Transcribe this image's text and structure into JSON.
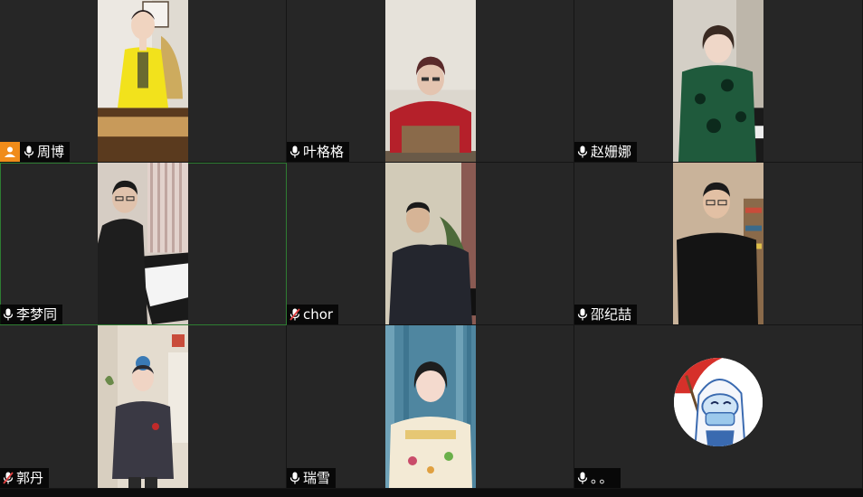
{
  "participants": [
    {
      "name": "周博",
      "muted": false,
      "host": true,
      "video_tone": "#d9c79a",
      "shirt": "#f2e21c",
      "bg": "#e8e4de"
    },
    {
      "name": "叶格格",
      "muted": false,
      "host": false,
      "video_tone": "#c9c2b8",
      "shirt": "#b5202a",
      "bg": "#d9d3c8"
    },
    {
      "name": "赵姗娜",
      "muted": false,
      "host": false,
      "video_tone": "#c8c4bc",
      "shirt": "#1f5a3c",
      "bg": "#cfc9be"
    },
    {
      "name": "李梦同",
      "muted": false,
      "host": false,
      "video_tone": "#d8d0c4",
      "shirt": "#1e1e1e",
      "bg": "#cdbfb6",
      "active": true
    },
    {
      "name": "chor",
      "muted": true,
      "host": false,
      "video_tone": "#c9c4b2",
      "shirt": "#24262e",
      "bg": "#cfc8b4"
    },
    {
      "name": "邵纪喆",
      "muted": false,
      "host": false,
      "video_tone": "#cdb79a",
      "shirt": "#141414",
      "bg": "#c9b39a"
    },
    {
      "name": "郭丹",
      "muted": true,
      "host": false,
      "video_tone": "#d9cfc2",
      "shirt": "#3a3944",
      "bg": "#e4dccf"
    },
    {
      "name": "瑞雪",
      "muted": false,
      "host": false,
      "video_tone": "#5c8fa6",
      "shirt": "#f3ead5",
      "bg": "#4f86a0"
    },
    {
      "name": "。。",
      "muted": false,
      "host": false,
      "avatar": true
    }
  ],
  "colors": {
    "host_badge": "#f08c1a",
    "active_border": "#2e7d32",
    "muted_slash": "#e04040"
  }
}
